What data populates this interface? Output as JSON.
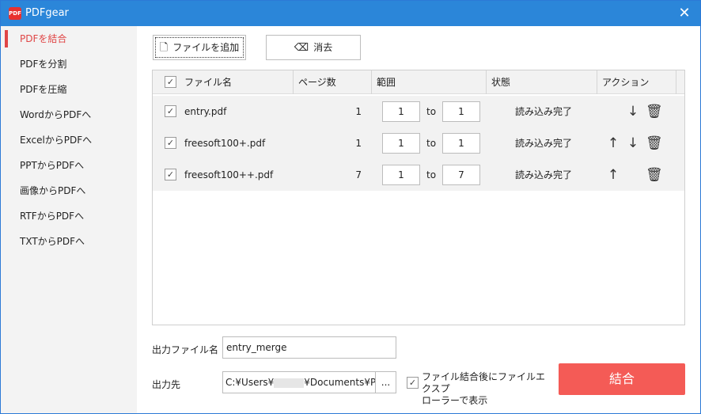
{
  "app": {
    "title": "PDFgear",
    "logo_text": "PDF"
  },
  "sidebar": {
    "items": [
      {
        "label": "PDFを結合",
        "active": true
      },
      {
        "label": "PDFを分割"
      },
      {
        "label": "PDFを圧縮"
      },
      {
        "label": "WordからPDFへ"
      },
      {
        "label": "ExcelからPDFへ"
      },
      {
        "label": "PPTからPDFへ"
      },
      {
        "label": "画像からPDFへ"
      },
      {
        "label": "RTFからPDFへ"
      },
      {
        "label": "TXTからPDFへ"
      }
    ]
  },
  "toolbar": {
    "add_file_label": "ファイルを追加",
    "clear_label": "消去"
  },
  "table": {
    "headers": {
      "file_name": "ファイル名",
      "pages": "ページ数",
      "range": "範囲",
      "status": "状態",
      "action": "アクション"
    },
    "range_to": "to",
    "rows": [
      {
        "name": "entry.pdf",
        "pages": "1",
        "from": "1",
        "to": "1",
        "status": "読み込み完了",
        "checked": true
      },
      {
        "name": "freesoft100+.pdf",
        "pages": "1",
        "from": "1",
        "to": "1",
        "status": "読み込み完了",
        "checked": true
      },
      {
        "name": "freesoft100++.pdf",
        "pages": "7",
        "from": "1",
        "to": "7",
        "status": "読み込み完了",
        "checked": true
      }
    ]
  },
  "output": {
    "name_label": "出力ファイル名",
    "name_value": "entry_merge",
    "dest_label": "出力先",
    "dest_prefix": "C:¥Users¥",
    "dest_suffix": "¥Documents¥PDFg",
    "browse_label": "...",
    "open_explorer_label_line1": "ファイル結合後にファイルエクスプ",
    "open_explorer_label_line2": "ローラーで表示",
    "open_explorer_checked": true
  },
  "merge_button": "結合",
  "colors": {
    "titlebar": "#2b86d9",
    "accent": "#e04646",
    "merge": "#f45b56"
  },
  "icons": {
    "add_file": "file-plus-icon",
    "clear": "eraser-icon",
    "up": "arrow-up-icon",
    "down": "arrow-down-icon",
    "delete": "trash-icon",
    "close": "close-icon"
  }
}
